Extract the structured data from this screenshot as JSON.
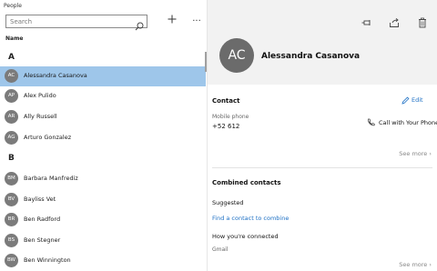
{
  "app": {
    "title": "People"
  },
  "toolbar": {
    "search_placeholder": "Search",
    "add_icon": "add-icon",
    "more_label": "..."
  },
  "list": {
    "column_header": "Name",
    "sections": [
      {
        "letter": "A"
      },
      {
        "letter": "B"
      }
    ],
    "contacts": [
      {
        "initials": "AC",
        "name": "Alessandra Casanova",
        "selected": true
      },
      {
        "initials": "AP",
        "name": "Alex Pulido",
        "selected": false
      },
      {
        "initials": "AR",
        "name": "Ally Russell",
        "selected": false
      },
      {
        "initials": "AG",
        "name": "Arturo Gonzalez",
        "selected": false
      },
      {
        "initials": "BM",
        "name": "Barbara Manfrediz",
        "selected": false
      },
      {
        "initials": "BV",
        "name": "Bayliss Vet",
        "selected": false
      },
      {
        "initials": "BR",
        "name": "Ben Radford",
        "selected": false
      },
      {
        "initials": "BS",
        "name": "Ben Stegner",
        "selected": false
      },
      {
        "initials": "BW",
        "name": "Ben Winnington",
        "selected": false
      }
    ]
  },
  "detail": {
    "initials": "AC",
    "name": "Alessandra Casanova",
    "contact_section": "Contact",
    "edit_label": "Edit",
    "phone_label": "Mobile phone",
    "phone_value": "+52 612",
    "call_label": "Call with Your Phone",
    "see_more_1": "See more",
    "combined_section": "Combined contacts",
    "suggested_label": "Suggested",
    "find_link": "Find a contact to combine",
    "connected_label": "How you're connected",
    "source_label": "Gmail",
    "see_more_2": "See more"
  },
  "colors": {
    "accent": "#1c6fc4",
    "selection": "#9ec6ea",
    "avatar": "#7b7b7b"
  }
}
